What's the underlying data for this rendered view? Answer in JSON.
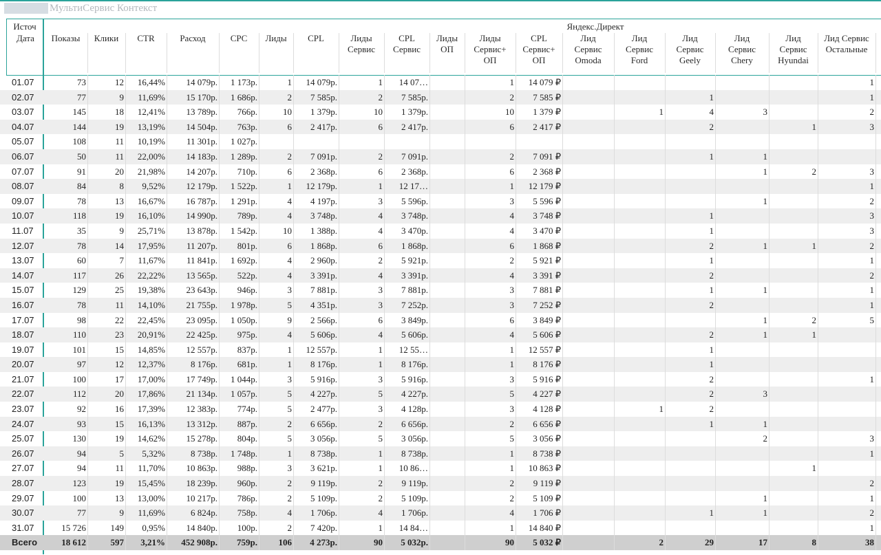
{
  "app_title": "МультиСервис Контекст",
  "header": {
    "source_label": "Источ",
    "group_label": "Яндекс.Директ",
    "columns": [
      "Дата",
      "Показы",
      "Клики",
      "CTR",
      "Расход",
      "CPC",
      "Лиды",
      "CPL",
      "Лиды\nСервис",
      "CPL\nСервис",
      "Лиды\nОП",
      "Лиды\nСервис+\nОП",
      "CPL\nСервис+\nОП",
      "Лид\nСервис\nOmoda",
      "Лид\nСервис\nFord",
      "Лид\nСервис\nGeely",
      "Лид\nСервис\nChery",
      "Лид\nСервис\nHyundai",
      "Лид Сервис\nОстальные"
    ]
  },
  "rows": [
    [
      "01.07",
      "73",
      "12",
      "16,44%",
      "14 079р.",
      "1 173р.",
      "1",
      "14 079р.",
      "1",
      "14 07…",
      "",
      "1",
      "14 079 ₽",
      "",
      "",
      "",
      "",
      "",
      "1"
    ],
    [
      "02.07",
      "77",
      "9",
      "11,69%",
      "15 170р.",
      "1 686р.",
      "2",
      "7 585р.",
      "2",
      "7 585р.",
      "",
      "2",
      "7 585 ₽",
      "",
      "",
      "1",
      "",
      "",
      "1"
    ],
    [
      "03.07",
      "145",
      "18",
      "12,41%",
      "13 789р.",
      "766р.",
      "10",
      "1 379р.",
      "10",
      "1 379р.",
      "",
      "10",
      "1 379 ₽",
      "",
      "1",
      "4",
      "3",
      "",
      "2"
    ],
    [
      "04.07",
      "144",
      "19",
      "13,19%",
      "14 504р.",
      "763р.",
      "6",
      "2 417р.",
      "6",
      "2 417р.",
      "",
      "6",
      "2 417 ₽",
      "",
      "",
      "2",
      "",
      "1",
      "3"
    ],
    [
      "05.07",
      "108",
      "11",
      "10,19%",
      "11 301р.",
      "1 027р.",
      "",
      "",
      "",
      "",
      "",
      "",
      "",
      "",
      "",
      "",
      "",
      "",
      ""
    ],
    [
      "06.07",
      "50",
      "11",
      "22,00%",
      "14 183р.",
      "1 289р.",
      "2",
      "7 091р.",
      "2",
      "7 091р.",
      "",
      "2",
      "7 091 ₽",
      "",
      "",
      "1",
      "1",
      "",
      ""
    ],
    [
      "07.07",
      "91",
      "20",
      "21,98%",
      "14 207р.",
      "710р.",
      "6",
      "2 368р.",
      "6",
      "2 368р.",
      "",
      "6",
      "2 368 ₽",
      "",
      "",
      "",
      "1",
      "2",
      "3"
    ],
    [
      "08.07",
      "84",
      "8",
      "9,52%",
      "12 179р.",
      "1 522р.",
      "1",
      "12 179р.",
      "1",
      "12 17…",
      "",
      "1",
      "12 179 ₽",
      "",
      "",
      "",
      "",
      "",
      "1"
    ],
    [
      "09.07",
      "78",
      "13",
      "16,67%",
      "16 787р.",
      "1 291р.",
      "4",
      "4 197р.",
      "3",
      "5 596р.",
      "",
      "3",
      "5 596 ₽",
      "",
      "",
      "",
      "1",
      "",
      "2"
    ],
    [
      "10.07",
      "118",
      "19",
      "16,10%",
      "14 990р.",
      "789р.",
      "4",
      "3 748р.",
      "4",
      "3 748р.",
      "",
      "4",
      "3 748 ₽",
      "",
      "",
      "1",
      "",
      "",
      "3"
    ],
    [
      "11.07",
      "35",
      "9",
      "25,71%",
      "13 878р.",
      "1 542р.",
      "10",
      "1 388р.",
      "4",
      "3 470р.",
      "",
      "4",
      "3 470 ₽",
      "",
      "",
      "1",
      "",
      "",
      "3"
    ],
    [
      "12.07",
      "78",
      "14",
      "17,95%",
      "11 207р.",
      "801р.",
      "6",
      "1 868р.",
      "6",
      "1 868р.",
      "",
      "6",
      "1 868 ₽",
      "",
      "",
      "2",
      "1",
      "1",
      "2"
    ],
    [
      "13.07",
      "60",
      "7",
      "11,67%",
      "11 841р.",
      "1 692р.",
      "4",
      "2 960р.",
      "2",
      "5 921р.",
      "",
      "2",
      "5 921 ₽",
      "",
      "",
      "1",
      "",
      "",
      "1"
    ],
    [
      "14.07",
      "117",
      "26",
      "22,22%",
      "13 565р.",
      "522р.",
      "4",
      "3 391р.",
      "4",
      "3 391р.",
      "",
      "4",
      "3 391 ₽",
      "",
      "",
      "2",
      "",
      "",
      "2"
    ],
    [
      "15.07",
      "129",
      "25",
      "19,38%",
      "23 643р.",
      "946р.",
      "3",
      "7 881р.",
      "3",
      "7 881р.",
      "",
      "3",
      "7 881 ₽",
      "",
      "",
      "1",
      "1",
      "",
      "1"
    ],
    [
      "16.07",
      "78",
      "11",
      "14,10%",
      "21 755р.",
      "1 978р.",
      "5",
      "4 351р.",
      "3",
      "7 252р.",
      "",
      "3",
      "7 252 ₽",
      "",
      "",
      "2",
      "",
      "",
      "1"
    ],
    [
      "17.07",
      "98",
      "22",
      "22,45%",
      "23 095р.",
      "1 050р.",
      "9",
      "2 566р.",
      "6",
      "3 849р.",
      "",
      "6",
      "3 849 ₽",
      "",
      "",
      "",
      "1",
      "2",
      "5"
    ],
    [
      "18.07",
      "110",
      "23",
      "20,91%",
      "22 425р.",
      "975р.",
      "4",
      "5 606р.",
      "4",
      "5 606р.",
      "",
      "4",
      "5 606 ₽",
      "",
      "",
      "2",
      "1",
      "1",
      ""
    ],
    [
      "19.07",
      "101",
      "15",
      "14,85%",
      "12 557р.",
      "837р.",
      "1",
      "12 557р.",
      "1",
      "12 55…",
      "",
      "1",
      "12 557 ₽",
      "",
      "",
      "1",
      "",
      "",
      ""
    ],
    [
      "20.07",
      "97",
      "12",
      "12,37%",
      "8 176р.",
      "681р.",
      "1",
      "8 176р.",
      "1",
      "8 176р.",
      "",
      "1",
      "8 176 ₽",
      "",
      "",
      "1",
      "",
      "",
      ""
    ],
    [
      "21.07",
      "100",
      "17",
      "17,00%",
      "17 749р.",
      "1 044р.",
      "3",
      "5 916р.",
      "3",
      "5 916р.",
      "",
      "3",
      "5 916 ₽",
      "",
      "",
      "2",
      "",
      "",
      "1"
    ],
    [
      "22.07",
      "112",
      "20",
      "17,86%",
      "21 134р.",
      "1 057р.",
      "5",
      "4 227р.",
      "5",
      "4 227р.",
      "",
      "5",
      "4 227 ₽",
      "",
      "",
      "2",
      "3",
      "",
      ""
    ],
    [
      "23.07",
      "92",
      "16",
      "17,39%",
      "12 383р.",
      "774р.",
      "5",
      "2 477р.",
      "3",
      "4 128р.",
      "",
      "3",
      "4 128 ₽",
      "",
      "1",
      "2",
      "",
      "",
      ""
    ],
    [
      "24.07",
      "93",
      "15",
      "16,13%",
      "13 312р.",
      "887р.",
      "2",
      "6 656р.",
      "2",
      "6 656р.",
      "",
      "2",
      "6 656 ₽",
      "",
      "",
      "1",
      "1",
      "",
      ""
    ],
    [
      "25.07",
      "130",
      "19",
      "14,62%",
      "15 278р.",
      "804р.",
      "5",
      "3 056р.",
      "5",
      "3 056р.",
      "",
      "5",
      "3 056 ₽",
      "",
      "",
      "",
      "2",
      "",
      "3"
    ],
    [
      "26.07",
      "94",
      "5",
      "5,32%",
      "8 738р.",
      "1 748р.",
      "1",
      "8 738р.",
      "1",
      "8 738р.",
      "",
      "1",
      "8 738 ₽",
      "",
      "",
      "",
      "",
      "",
      "1"
    ],
    [
      "27.07",
      "94",
      "11",
      "11,70%",
      "10 863р.",
      "988р.",
      "3",
      "3 621р.",
      "1",
      "10 86…",
      "",
      "1",
      "10 863 ₽",
      "",
      "",
      "",
      "",
      "1",
      ""
    ],
    [
      "28.07",
      "123",
      "19",
      "15,45%",
      "18 239р.",
      "960р.",
      "2",
      "9 119р.",
      "2",
      "9 119р.",
      "",
      "2",
      "9 119 ₽",
      "",
      "",
      "",
      "",
      "",
      "2"
    ],
    [
      "29.07",
      "100",
      "13",
      "13,00%",
      "10 217р.",
      "786р.",
      "2",
      "5 109р.",
      "2",
      "5 109р.",
      "",
      "2",
      "5 109 ₽",
      "",
      "",
      "",
      "1",
      "",
      "1"
    ],
    [
      "30.07",
      "77",
      "9",
      "11,69%",
      "6 824р.",
      "758р.",
      "4",
      "1 706р.",
      "4",
      "1 706р.",
      "",
      "4",
      "1 706 ₽",
      "",
      "",
      "1",
      "1",
      "",
      "2"
    ],
    [
      "31.07",
      "15 726",
      "149",
      "0,95%",
      "14 840р.",
      "100р.",
      "2",
      "7 420р.",
      "1",
      "14 84…",
      "",
      "1",
      "14 840 ₽",
      "",
      "",
      "",
      "",
      "",
      "1"
    ]
  ],
  "total": [
    "Всего",
    "18 612",
    "597",
    "3,21%",
    "452 908р.",
    "759р.",
    "106",
    "4 273р.",
    "90",
    "5 032р.",
    "",
    "90",
    "5 032 ₽",
    "",
    "2",
    "29",
    "17",
    "8",
    "38"
  ]
}
